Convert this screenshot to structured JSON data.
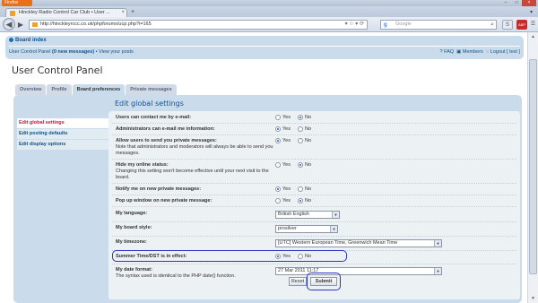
{
  "browser": {
    "menu_label": "Firefox",
    "tab_title": "Hinckley Radio Control Car Club • User ...",
    "new_tab": "+",
    "url": "http://hinckleyrccc.co.uk/phpforums/ucp.php?i=165",
    "search_placeholder": "Google",
    "search_engine_glyph": "g",
    "min": "–",
    "max": "□",
    "close": "×",
    "back": "◀",
    "forward": "▶",
    "url_icons": "▾ ☆ ▾ ⟳",
    "tab_close": "×",
    "tab_list": "▾",
    "abp_label": "ABP",
    "s_label": "S",
    "menu_glyph": "☰"
  },
  "nav": {
    "board_index": "Board index",
    "ucp_link": "User Control Panel",
    "messages": "(0 new messages)",
    "view_posts": "• View your posts",
    "faq": "FAQ",
    "members": "Members",
    "logout": "Logout [ test ]"
  },
  "page_title": "User Control Panel",
  "tabs": [
    "Overview",
    "Profile",
    "Board preferences",
    "Private messages"
  ],
  "active_tab": "Board preferences",
  "side_menu": [
    "Edit global settings",
    "Edit posting defaults",
    "Edit display options"
  ],
  "panel_title": "Edit global settings",
  "radio_labels": {
    "yes": "Yes",
    "no": "No"
  },
  "settings": [
    {
      "label": "Users can contact me by e-mail:",
      "desc": "",
      "value": "No"
    },
    {
      "label": "Administrators can e-mail me information:",
      "desc": "",
      "value": "Yes"
    },
    {
      "label": "Allow users to send you private messages:",
      "desc": "Note that administrators and moderators will always be able to send you messages.",
      "value": "Yes"
    },
    {
      "label": "Hide my online status:",
      "desc": "Changing this setting won't become effective until your next visit to the board.",
      "value": "No"
    },
    {
      "label": "Notify me on new private messages:",
      "desc": "",
      "value": "Yes"
    },
    {
      "label": "Pop up window on new private message:",
      "desc": "",
      "value": "No"
    }
  ],
  "selects": {
    "language_label": "My language:",
    "language_value": "British English",
    "style_label": "My board style:",
    "style_value": "prosilver",
    "timezone_label": "My timezone:",
    "timezone_value": "[UTC] Western European Time, Greenwich Mean Time"
  },
  "dst": {
    "label": "Summer Time/DST is in effect:",
    "value": "Yes"
  },
  "date_format": {
    "label": "My date format:",
    "desc": "The syntax used is identical to the PHP date() function.",
    "value": "27 Mar 2011 11:17"
  },
  "buttons": {
    "reset": "Reset",
    "submit": "Submit"
  },
  "colors": {
    "accent": "#105289",
    "highlight": "#2c33c7",
    "active_menu": "#d31141"
  }
}
